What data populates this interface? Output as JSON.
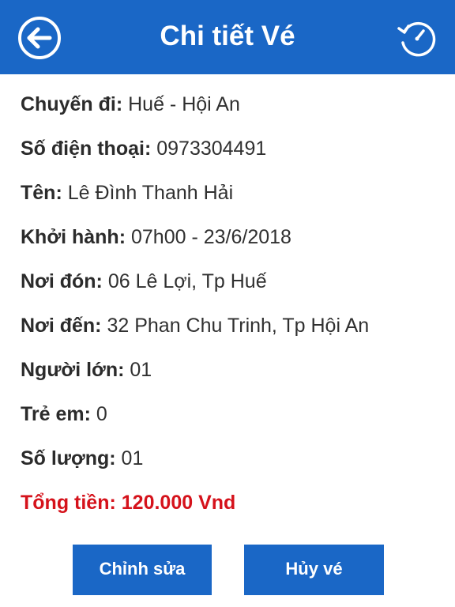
{
  "header": {
    "title": "Chi tiết Vé",
    "back_icon": "arrow-left-circle-icon",
    "history_icon": "history-icon"
  },
  "details": {
    "route_label": "Chuyến đi:",
    "route_value": "Huế - Hội An",
    "phone_label": "Số điện thoại:",
    "phone_value": "0973304491",
    "name_label": "Tên:",
    "name_value": "Lê Đình Thanh Hải",
    "departure_label": "Khởi hành:",
    "departure_value": "07h00 - 23/6/2018",
    "pickup_label": "Nơi đón:",
    "pickup_value": "06 Lê Lợi, Tp Huế",
    "dropoff_label": "Nơi đến:",
    "dropoff_value": "32 Phan Chu Trinh, Tp Hội An",
    "adults_label": "Người lớn:",
    "adults_value": "01",
    "children_label": "Trẻ em:",
    "children_value": "0",
    "quantity_label": "Số lượng:",
    "quantity_value": "01",
    "total_label": "Tổng tiền:",
    "total_value": "120.000 Vnd"
  },
  "actions": {
    "edit_label": "Chỉnh sửa",
    "cancel_label": "Hủy vé"
  },
  "colors": {
    "primary": "#1a67c6",
    "total": "#d5121b",
    "text": "#303030"
  }
}
